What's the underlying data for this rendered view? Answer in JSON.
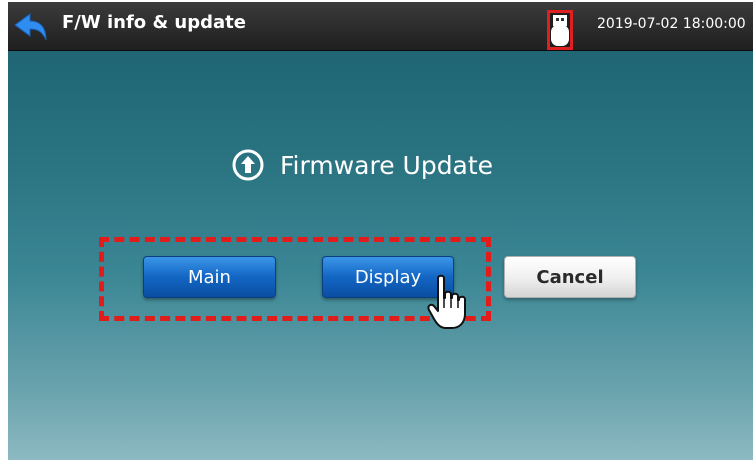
{
  "header": {
    "title": "F/W info & update",
    "datetime": "2019-07-02 18:00:00",
    "back_icon": "back-arrow-icon",
    "usb_icon": "usb-drive-icon"
  },
  "main": {
    "heading": "Firmware Update",
    "heading_icon": "upload-circle-icon",
    "buttons": {
      "main": "Main",
      "display": "Display",
      "cancel": "Cancel"
    }
  },
  "colors": {
    "highlight": "#e21b1b",
    "button_blue": "#1366c4",
    "background": "#2a7482"
  }
}
